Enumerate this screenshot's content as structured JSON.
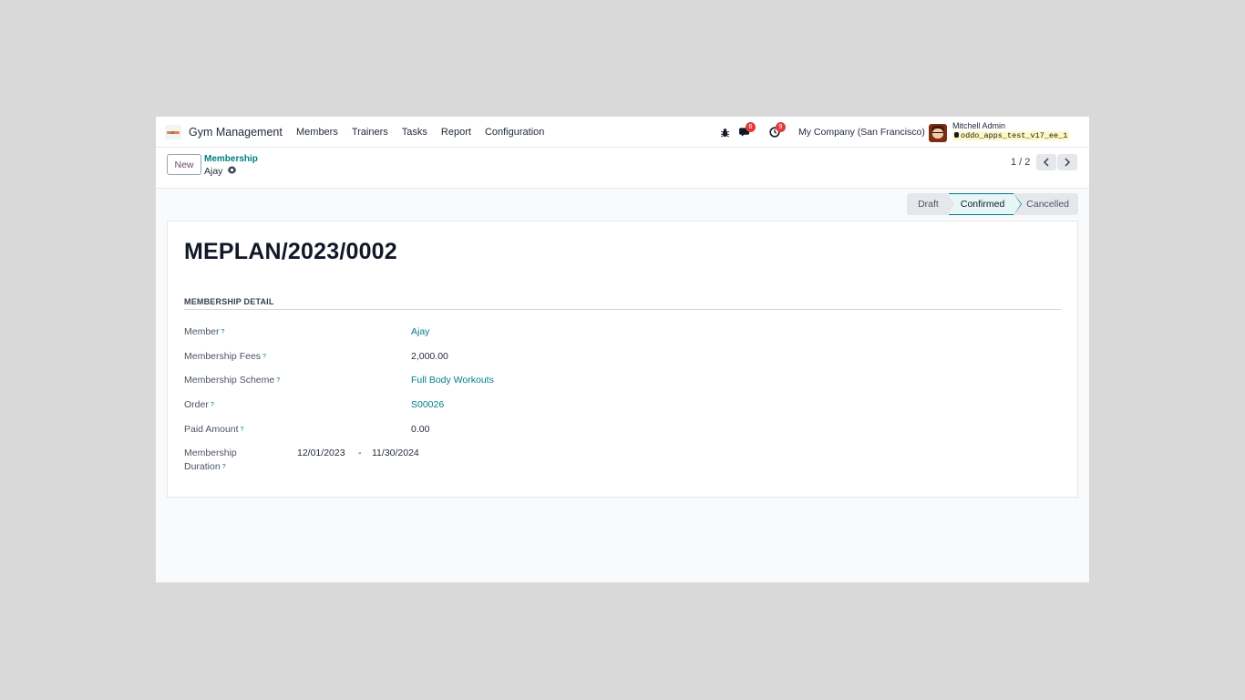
{
  "navbar": {
    "app_name": "Gym Management",
    "menu": [
      "Members",
      "Trainers",
      "Tasks",
      "Report",
      "Configuration"
    ],
    "messages_count": "6",
    "activities_count": "9",
    "company": "My Company (San Francisco)",
    "user_name": "Mitchell Admin",
    "database": "oddo_apps_test_v17_ee_1"
  },
  "control": {
    "new_label": "New",
    "breadcrumb_parent": "Membership",
    "breadcrumb_current": "Ajay",
    "pager": "1 / 2"
  },
  "status": {
    "stages": [
      "Draft",
      "Confirmed",
      "Cancelled"
    ],
    "active": "Confirmed"
  },
  "form": {
    "title": "MEPLAN/2023/0002",
    "section": "MEMBERSHIP DETAIL",
    "help_mark": "?",
    "fields": {
      "member_label": "Member",
      "member_value": "Ajay",
      "fees_label": "Membership Fees",
      "fees_value": "2,000.00",
      "scheme_label": "Membership Scheme",
      "scheme_value": "Full Body Workouts",
      "order_label": "Order",
      "order_value": "S00026",
      "paid_label": "Paid Amount",
      "paid_value": "0.00",
      "duration_label_1": "Membership",
      "duration_label_2": "Duration",
      "duration_start": "12/01/2023",
      "duration_sep": "-",
      "duration_end": "11/30/2024"
    }
  },
  "colors": {
    "accent": "#017e84",
    "brand": "#714b67",
    "badge": "#e23a3a"
  }
}
